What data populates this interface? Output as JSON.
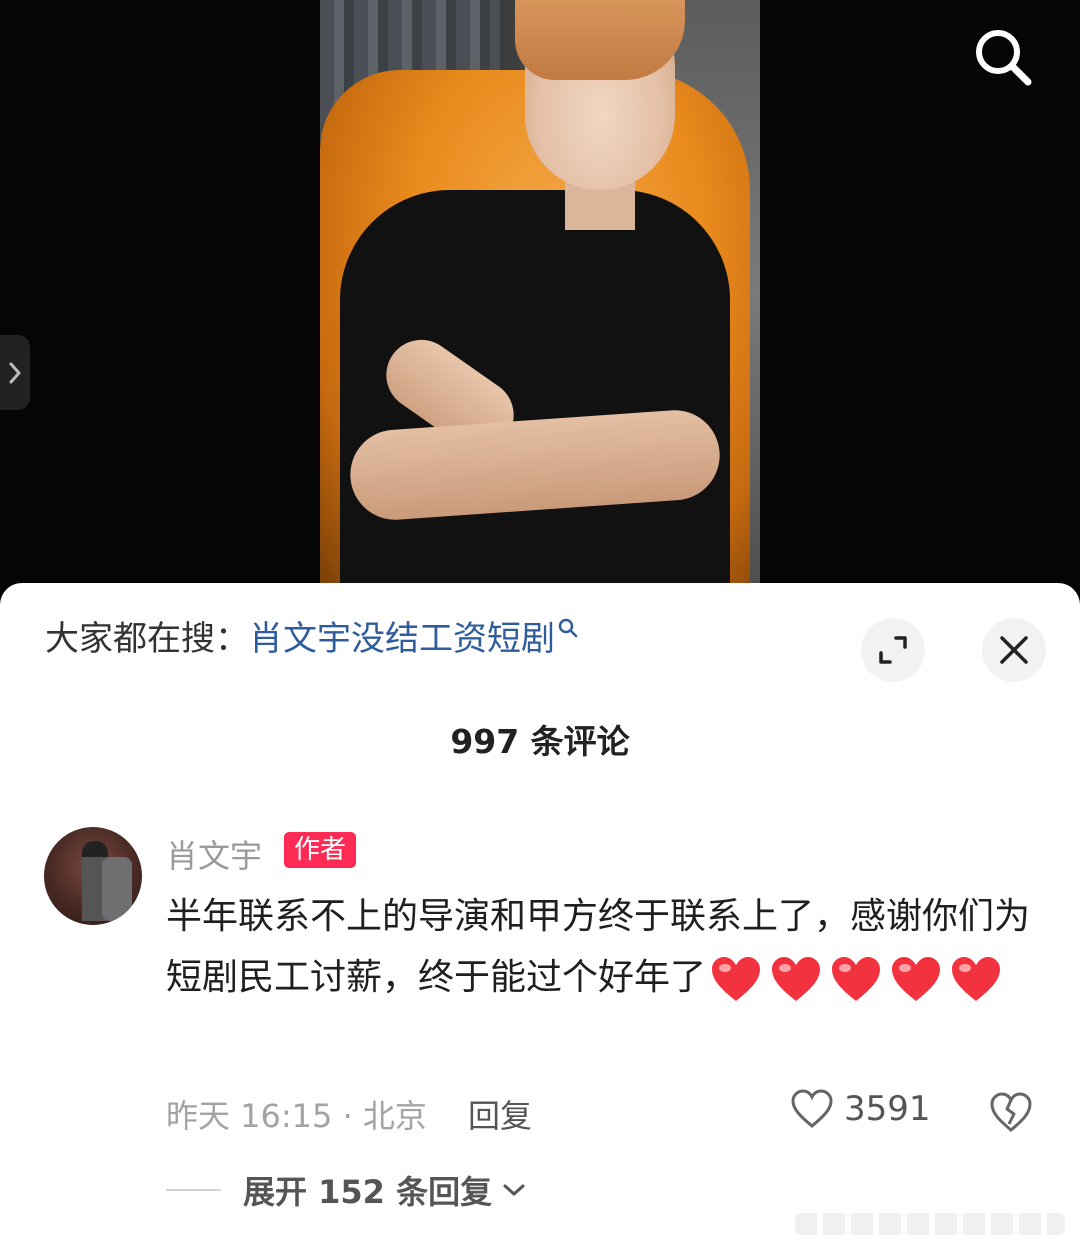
{
  "video": {
    "search_icon": "search-icon",
    "side_arrow_icon": "chevron-right-icon"
  },
  "sheet": {
    "hot_search_prefix": "大家都在搜：",
    "hot_search_keyword": "肖文宇没结工资短剧",
    "expand_icon": "expand-icon",
    "close_icon": "close-icon",
    "comment_count_label": "997 条评论"
  },
  "comment": {
    "username": "肖文宇",
    "badge": "作者",
    "text": "半年联系不上的导演和甲方终于联系上了，感谢你们为短剧民工讨薪，终于能过个好年了",
    "heart_emoji_count": 5,
    "time_location": "昨天 16:15 · 北京",
    "reply_label": "回复",
    "like_count": "3591",
    "expand_replies_label": "展开 152 条回复"
  },
  "colors": {
    "accent_red": "#fe2c55",
    "keyword_blue": "#2f5d9c",
    "heart_red": "#f2323f"
  }
}
